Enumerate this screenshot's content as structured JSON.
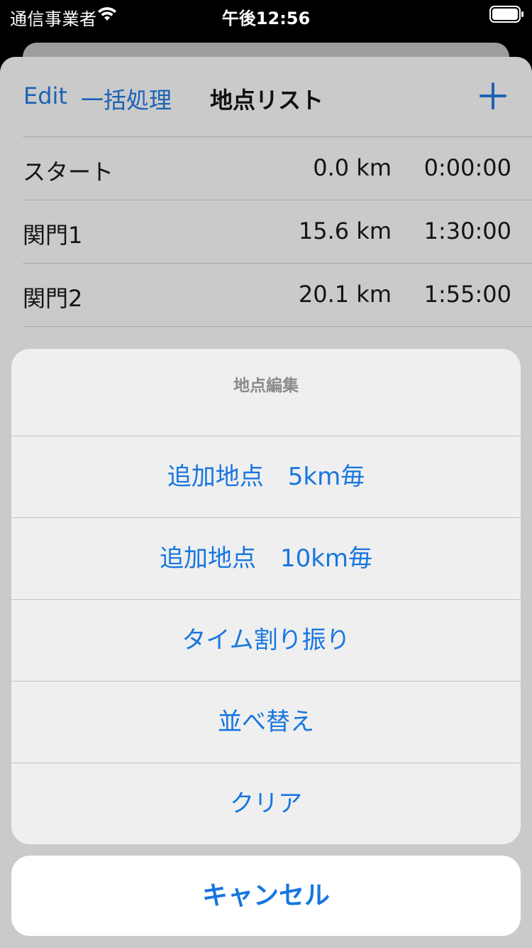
{
  "status_bar": {
    "carrier": "通信事業者",
    "time": "午後12:56",
    "icons": [
      "wifi-icon",
      "battery-icon"
    ]
  },
  "nav": {
    "edit_label": "Edit",
    "batch_label": "一括処理",
    "title": "地点リスト",
    "add_icon": "plus-icon"
  },
  "points": [
    {
      "name": "スタート",
      "distance": "0.0 km",
      "time": "0:00:00"
    },
    {
      "name": "関門1",
      "distance": "15.6 km",
      "time": "1:30:00"
    },
    {
      "name": "関門2",
      "distance": "20.1 km",
      "time": "1:55:00"
    }
  ],
  "action_sheet": {
    "title": "地点編集",
    "actions": [
      "追加地点　5km毎",
      "追加地点　10km毎",
      "タイム割り振り",
      "並べ替え",
      "クリア"
    ],
    "cancel_label": "キャンセル"
  },
  "colors": {
    "accent": "#1776e0",
    "nav_accent_dimmed": "#1a63b4",
    "dim_background": "#cacaca",
    "action_background": "#efefef"
  }
}
